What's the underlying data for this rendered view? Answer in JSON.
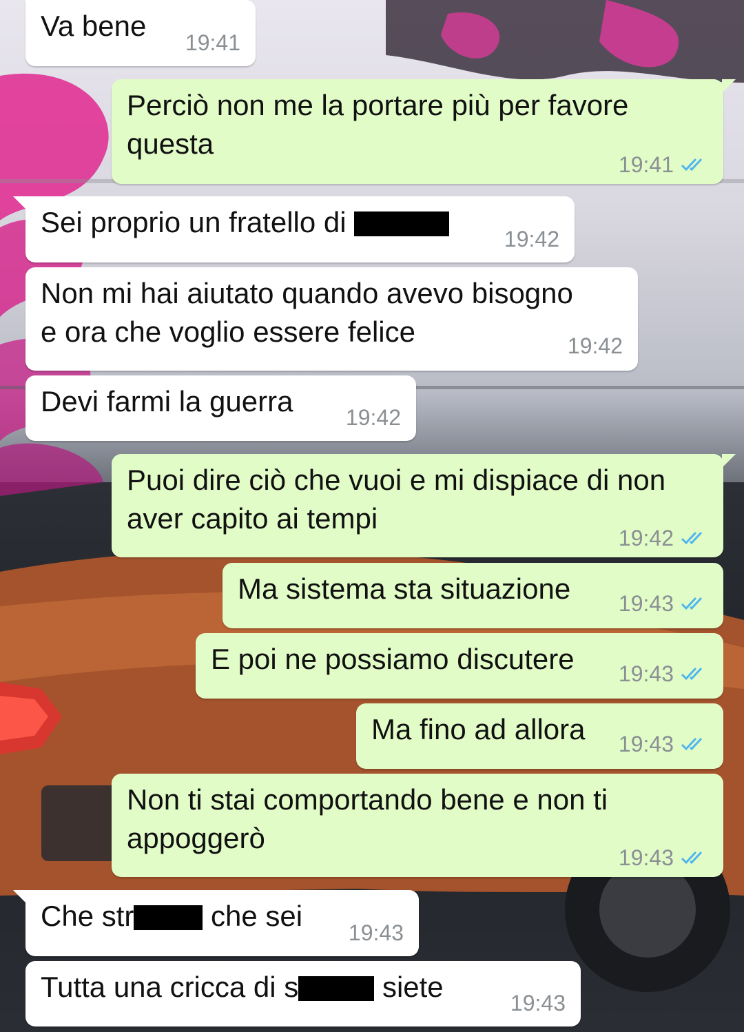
{
  "conversation": {
    "messages": [
      {
        "id": "m1",
        "direction": "in",
        "text": "Va bene",
        "time": "19:41"
      },
      {
        "id": "m2",
        "direction": "out",
        "text": "Perciò non me la portare più per favore\nquesta",
        "time": "19:41",
        "status": "read"
      },
      {
        "id": "m3",
        "direction": "in",
        "text_before": "Sei proprio un fratello di ",
        "text_after": "",
        "redacted": true,
        "time": "19:42"
      },
      {
        "id": "m4",
        "direction": "in",
        "text": "Non mi hai aiutato quando avevo bisogno\ne ora che voglio essere felice",
        "time": "19:42"
      },
      {
        "id": "m5",
        "direction": "in",
        "text": "Devi farmi la guerra",
        "time": "19:42"
      },
      {
        "id": "m6",
        "direction": "out",
        "text": "Puoi dire ciò che vuoi e mi dispiace di non\naver capito ai tempi",
        "time": "19:42",
        "status": "read"
      },
      {
        "id": "m7",
        "direction": "out",
        "text": "Ma sistema sta situazione",
        "time": "19:43",
        "status": "read"
      },
      {
        "id": "m8",
        "direction": "out",
        "text": "E poi ne possiamo discutere",
        "time": "19:43",
        "status": "read"
      },
      {
        "id": "m9",
        "direction": "out",
        "text": "Ma fino ad allora",
        "time": "19:43",
        "status": "read"
      },
      {
        "id": "m10",
        "direction": "out",
        "text": "Non ti stai comportando bene e non ti\nappoggerò",
        "time": "19:43",
        "status": "read"
      },
      {
        "id": "m11",
        "direction": "in",
        "text_before": "Che str",
        "text_after": " che sei",
        "redacted": true,
        "time": "19:43"
      },
      {
        "id": "m12",
        "direction": "in",
        "text_before": "Tutta una cricca di s",
        "text_after": " siete",
        "redacted": true,
        "time": "19:43"
      }
    ]
  },
  "icons": {
    "read_receipt": "double-check-icon"
  },
  "colors": {
    "incoming_bubble": "#ffffff",
    "outgoing_bubble": "#e2fcc8",
    "timestamp": "#8a8f93",
    "read_ticks": "#4fb6ec",
    "redaction": "#000000"
  }
}
